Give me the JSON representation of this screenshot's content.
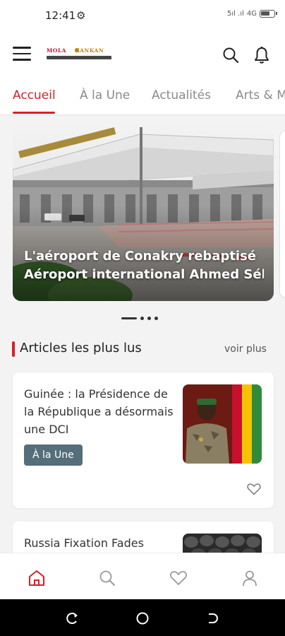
{
  "status_bar": {
    "time": "12:41",
    "signal_text": "5ıl .ıl",
    "network_text": "4G"
  },
  "header": {
    "logo": {
      "word1": "MOLA",
      "word2": "KANKAN"
    },
    "icons": [
      "hamburger-icon",
      "search-icon",
      "bell-icon"
    ]
  },
  "tabs": [
    {
      "label": "Accueil",
      "active": true
    },
    {
      "label": "À la Une",
      "active": false
    },
    {
      "label": "Actualités",
      "active": false
    },
    {
      "label": "Arts & Me",
      "active": false
    }
  ],
  "carousel": {
    "caption_line1": "L'aéroport de Conakry rebaptisé",
    "caption_line2": "Aéroport international Ahmed Séko...",
    "slide_count": 4,
    "active_slide": 0
  },
  "section": {
    "title": "Articles les plus lus",
    "see_more": "voir plus"
  },
  "articles": [
    {
      "title": "Guinée : la Présidence de la République a désormais une DCI",
      "badge": "À la Une",
      "favorited": false
    },
    {
      "title": "Russia Fixation Fades"
    }
  ],
  "bottom_nav": [
    {
      "icon": "home-icon",
      "active": true
    },
    {
      "icon": "search-icon",
      "active": false
    },
    {
      "icon": "heart-icon",
      "active": false
    },
    {
      "icon": "profile-icon",
      "active": false
    }
  ],
  "colors": {
    "accent": "#d71f27",
    "badge": "#546e7a",
    "tab_inactive": "#8a8a8a",
    "background": "#f3f3f3"
  }
}
